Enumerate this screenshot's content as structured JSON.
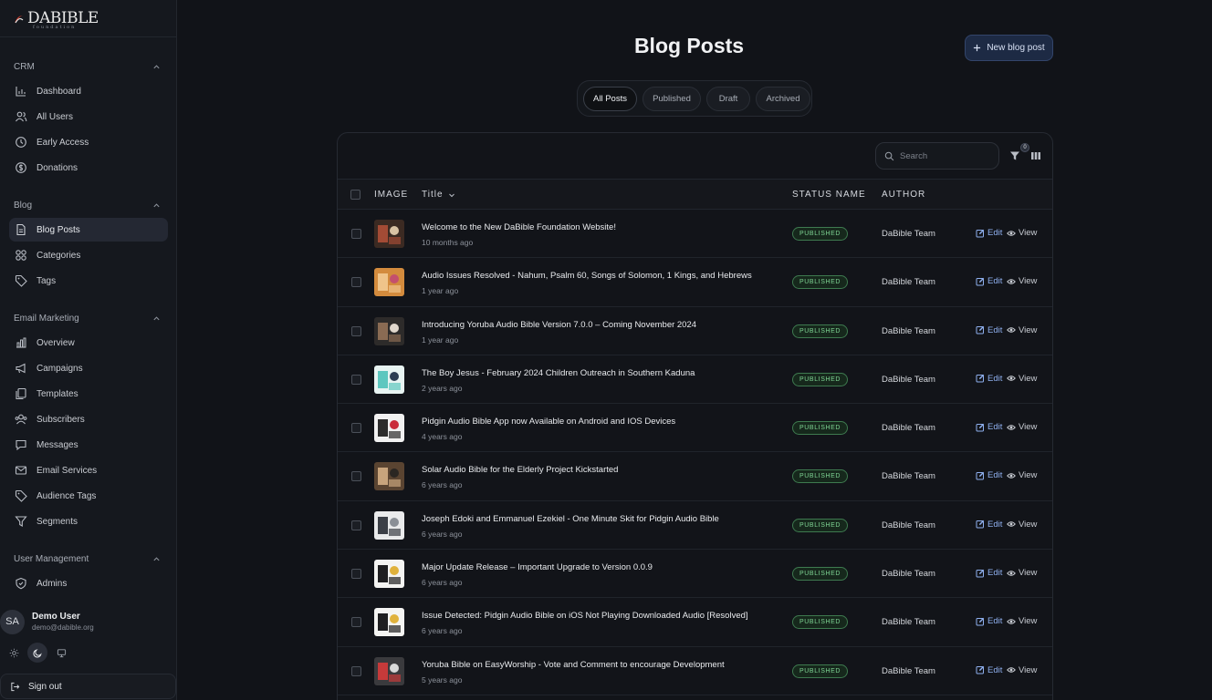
{
  "brand": {
    "logo_text": "DABIBLE",
    "logo_sub": "foundation"
  },
  "sidebar": {
    "sections": [
      {
        "title": "CRM",
        "items": [
          {
            "label": "Dashboard",
            "icon": "chart-icon"
          },
          {
            "label": "All Users",
            "icon": "users-icon"
          },
          {
            "label": "Early Access",
            "icon": "clock-icon"
          },
          {
            "label": "Donations",
            "icon": "dollar-icon"
          }
        ]
      },
      {
        "title": "Blog",
        "items": [
          {
            "label": "Blog Posts",
            "icon": "file-icon",
            "active": true
          },
          {
            "label": "Categories",
            "icon": "grid-icon"
          },
          {
            "label": "Tags",
            "icon": "tag-icon"
          }
        ]
      },
      {
        "title": "Email Marketing",
        "items": [
          {
            "label": "Overview",
            "icon": "bar-chart-icon"
          },
          {
            "label": "Campaigns",
            "icon": "megaphone-icon"
          },
          {
            "label": "Templates",
            "icon": "copy-icon"
          },
          {
            "label": "Subscribers",
            "icon": "subscribers-icon"
          },
          {
            "label": "Messages",
            "icon": "message-icon"
          },
          {
            "label": "Email Services",
            "icon": "mail-icon"
          },
          {
            "label": "Audience Tags",
            "icon": "tag-icon"
          },
          {
            "label": "Segments",
            "icon": "filter-icon"
          }
        ]
      },
      {
        "title": "User Management",
        "items": [
          {
            "label": "Admins",
            "icon": "shield-icon"
          }
        ]
      }
    ],
    "user": {
      "initials": "SA",
      "name": "Demo User",
      "email": "demo@dabible.org"
    },
    "theme_active": "dark",
    "signout_label": "Sign out"
  },
  "header": {
    "title": "Blog Posts",
    "new_post_label": "New blog post"
  },
  "tabs": [
    {
      "label": "All Posts",
      "active": true
    },
    {
      "label": "Published"
    },
    {
      "label": "Draft"
    },
    {
      "label": "Archived"
    }
  ],
  "toolbar": {
    "search_placeholder": "Search",
    "filter_count": "0"
  },
  "table": {
    "columns": {
      "image": "IMAGE",
      "title": "Title",
      "status": "STATUS NAME",
      "author": "AUTHOR"
    },
    "edit_label": "Edit",
    "view_label": "View",
    "rows": [
      {
        "title": "Welcome to the New DaBible Foundation Website!",
        "date": "10 months ago",
        "status": "PUBLISHED",
        "author": "DaBible Team"
      },
      {
        "title": "Audio Issues Resolved - Nahum, Psalm 60, Songs of Solomon, 1 Kings, and Hebrews",
        "date": "1 year ago",
        "status": "PUBLISHED",
        "author": "DaBible Team"
      },
      {
        "title": "Introducing Yoruba Audio Bible Version 7.0.0 – Coming November 2024",
        "date": "1 year ago",
        "status": "PUBLISHED",
        "author": "DaBible Team"
      },
      {
        "title": "The Boy Jesus - February 2024 Children Outreach in Southern Kaduna",
        "date": "2 years ago",
        "status": "PUBLISHED",
        "author": "DaBible Team"
      },
      {
        "title": "Pidgin Audio Bible App now Available on Android and IOS Devices",
        "date": "4 years ago",
        "status": "PUBLISHED",
        "author": "DaBible Team"
      },
      {
        "title": "Solar Audio Bible for the Elderly Project Kickstarted",
        "date": "6 years ago",
        "status": "PUBLISHED",
        "author": "DaBible Team"
      },
      {
        "title": "Joseph Edoki and Emmanuel Ezekiel - One Minute Skit for Pidgin Audio Bible",
        "date": "6 years ago",
        "status": "PUBLISHED",
        "author": "DaBible Team"
      },
      {
        "title": "Major Update Release – Important Upgrade to Version 0.0.9",
        "date": "6 years ago",
        "status": "PUBLISHED",
        "author": "DaBible Team"
      },
      {
        "title": "Issue Detected: Pidgin Audio Bible on iOS Not Playing Downloaded Audio [Resolved]",
        "date": "6 years ago",
        "status": "PUBLISHED",
        "author": "DaBible Team"
      },
      {
        "title": "Yoruba Bible on EasyWorship - Vote and Comment to encourage Development",
        "date": "5 years ago",
        "status": "PUBLISHED",
        "author": "DaBible Team"
      }
    ]
  },
  "colors": {
    "accent": "#8fb0ef",
    "published_badge": "#7fd594",
    "background": "#111318"
  }
}
